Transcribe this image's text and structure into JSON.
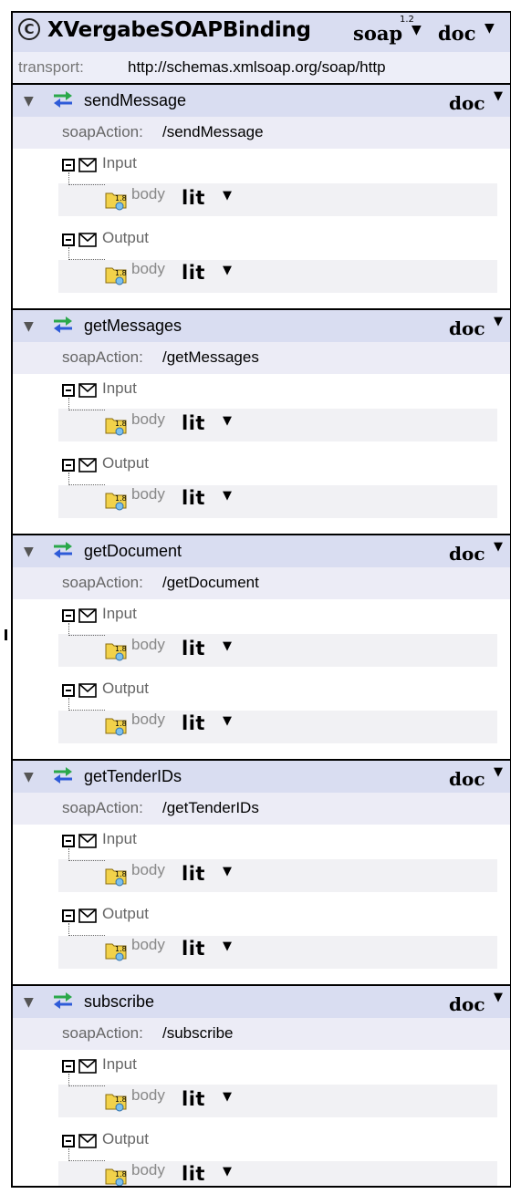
{
  "binding": {
    "title": "XVergabeSOAPBinding",
    "soap_label": "soap",
    "soap_version": "1.2",
    "style": "doc",
    "transport_label": "transport:",
    "transport_value": "http://schemas.xmlsoap.org/soap/http"
  },
  "operations": [
    {
      "name": "sendMessage",
      "style": "doc",
      "soap_action_label": "soapAction:",
      "soap_action": "/sendMessage",
      "input_label": "Input",
      "output_label": "Output",
      "body_label": "body",
      "use": "lit"
    },
    {
      "name": "getMessages",
      "style": "doc",
      "soap_action_label": "soapAction:",
      "soap_action": "/getMessages",
      "input_label": "Input",
      "output_label": "Output",
      "body_label": "body",
      "use": "lit"
    },
    {
      "name": "getDocument",
      "style": "doc",
      "soap_action_label": "soapAction:",
      "soap_action": "/getDocument",
      "input_label": "Input",
      "output_label": "Output",
      "body_label": "body",
      "use": "lit"
    },
    {
      "name": "getTenderIDs",
      "style": "doc",
      "soap_action_label": "soapAction:",
      "soap_action": "/getTenderIDs",
      "input_label": "Input",
      "output_label": "Output",
      "body_label": "body",
      "use": "lit"
    },
    {
      "name": "subscribe",
      "style": "doc",
      "soap_action_label": "soapAction:",
      "soap_action": "/subscribe",
      "input_label": "Input",
      "output_label": "Output",
      "body_label": "body",
      "use": "lit"
    }
  ],
  "icons": {
    "binding": "c-circle-icon",
    "expand": "triangle-down-icon",
    "operation": "exchange-arrows-icon",
    "collapse": "minus-box-icon",
    "message": "envelope-icon",
    "body": "body-part-icon",
    "dropdown": "dropdown-arrow-icon"
  },
  "colors": {
    "header_bg": "#d9ddf1",
    "subheader_bg": "#ececf6",
    "arrow_green": "#2aa84a",
    "arrow_blue": "#2e5bd8"
  }
}
